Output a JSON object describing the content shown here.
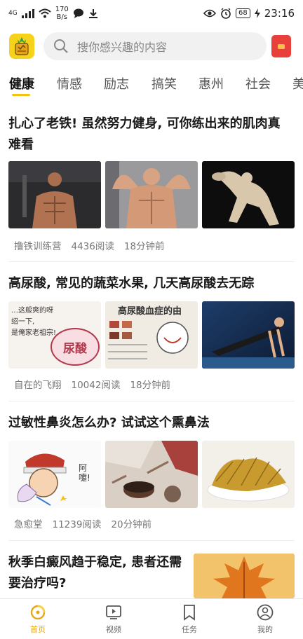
{
  "status_bar": {
    "network": "4G",
    "speed_value": "170",
    "speed_unit": "B/s",
    "battery": "68",
    "time": "23:16"
  },
  "search": {
    "placeholder": "搜你感兴趣的内容"
  },
  "tabs": [
    "健康",
    "情感",
    "励志",
    "搞笑",
    "惠州",
    "社会",
    "美"
  ],
  "active_tab": "健康",
  "articles": [
    {
      "title": "扎心了老铁! 虽然努力健身, 可你练出来的肌肉真难看",
      "source": "撸铁训练营",
      "reads": "4436阅读",
      "time": "18分钟前"
    },
    {
      "title": "高尿酸, 常见的蔬菜水果, 几天高尿酸去无踪",
      "source": "自在的飞翔",
      "reads": "10042阅读",
      "time": "18分钟前",
      "image_texts": {
        "img1_line1": "…这般爽的呀",
        "img1_line2": "绍一下,",
        "img1_line3": "是俺家老祖宗!",
        "img1_bubble": "尿酸",
        "img2_title": "高尿酸血症的由"
      }
    },
    {
      "title": "过敏性鼻炎怎么办? 试试这个熏鼻法",
      "source": "急愈堂",
      "reads": "11239阅读",
      "time": "20分钟前",
      "image_texts": {
        "img1_sneeze": "阿嚏!"
      }
    },
    {
      "title": "秋季白癜风趋于稳定, 患者还需要治疗吗?"
    }
  ],
  "bottom_nav": [
    {
      "label": "首页",
      "icon": "home-icon",
      "active": true
    },
    {
      "label": "视频",
      "icon": "video-icon",
      "active": false
    },
    {
      "label": "任务",
      "icon": "task-icon",
      "active": false
    },
    {
      "label": "我的",
      "icon": "profile-icon",
      "active": false
    }
  ],
  "colors": {
    "accent": "#f3c214",
    "nav_active": "#e6a817",
    "red_packet": "#e8413b"
  }
}
